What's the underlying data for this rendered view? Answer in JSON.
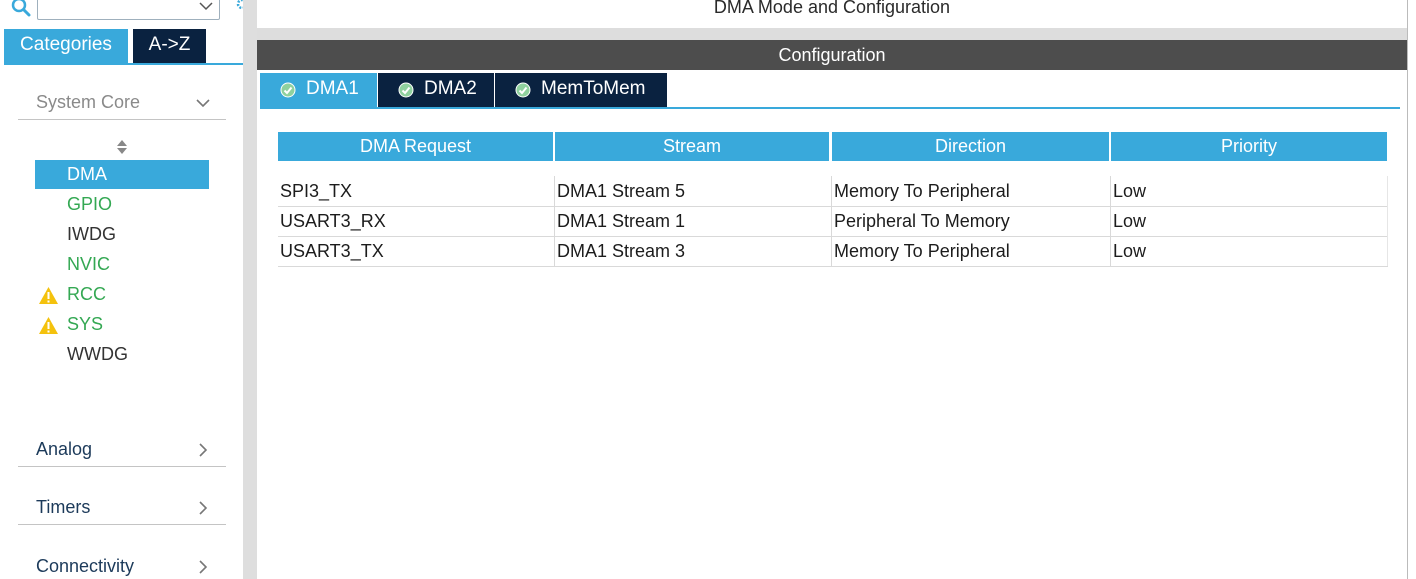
{
  "sidebar": {
    "search": {
      "value": "",
      "placeholder": ""
    },
    "tabs": [
      {
        "label": "Categories",
        "active": true
      },
      {
        "label": "A->Z",
        "active": false
      }
    ],
    "categories": {
      "system_core": {
        "label": "System Core",
        "expanded": true,
        "items": [
          {
            "label": "DMA",
            "state": "selected",
            "warning": false
          },
          {
            "label": "GPIO",
            "state": "configured",
            "warning": false
          },
          {
            "label": "IWDG",
            "state": "normal",
            "warning": false
          },
          {
            "label": "NVIC",
            "state": "configured",
            "warning": false
          },
          {
            "label": "RCC",
            "state": "configured",
            "warning": true
          },
          {
            "label": "SYS",
            "state": "configured",
            "warning": true
          },
          {
            "label": "WWDG",
            "state": "normal",
            "warning": false
          }
        ]
      },
      "analog": {
        "label": "Analog",
        "expanded": false
      },
      "timers": {
        "label": "Timers",
        "expanded": false
      },
      "connectivity": {
        "label": "Connectivity",
        "expanded": false
      }
    }
  },
  "main": {
    "mode_title": "DMA Mode and Configuration",
    "config_title": "Configuration",
    "tabs": [
      {
        "label": "DMA1",
        "active": true
      },
      {
        "label": "DMA2",
        "active": false
      },
      {
        "label": "MemToMem",
        "active": false
      }
    ],
    "table": {
      "columns": [
        "DMA Request",
        "Stream",
        "Direction",
        "Priority"
      ],
      "rows": [
        [
          "SPI3_TX",
          "DMA1 Stream 5",
          "Memory To Peripheral",
          "Low"
        ],
        [
          "USART3_RX",
          "DMA1 Stream 1",
          "Peripheral To Memory",
          "Low"
        ],
        [
          "USART3_TX",
          "DMA1 Stream 3",
          "Memory To Peripheral",
          "Low"
        ]
      ]
    }
  },
  "colors": {
    "accent": "#39a9db",
    "navy": "#0a2240",
    "configured_green": "#34a853",
    "warning_yellow": "#f4c20d",
    "header_gray": "#4d4d4d"
  }
}
